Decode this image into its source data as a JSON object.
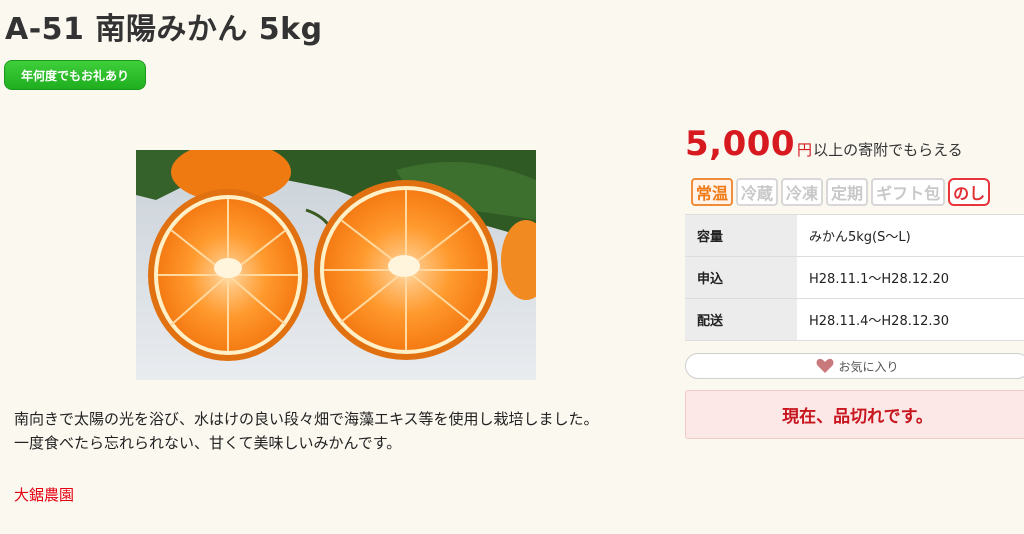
{
  "product": {
    "title": "A-51 南陽みかん 5kg",
    "badge": "年何度でもお礼あり",
    "description_lines": [
      "南向きで太陽の光を浴び、水はけの良い段々畑で海藻エキス等を使用し栽培しました。",
      "一度食べたら忘れられない、甘くて美味しいみかんです。"
    ],
    "farm": "大鋸農園"
  },
  "price": {
    "amount": "5,000",
    "unit": "円",
    "suffix": "以上の寄附でもらえる"
  },
  "tags": [
    {
      "label": "常温",
      "active": true
    },
    {
      "label": "冷蔵",
      "active": false
    },
    {
      "label": "冷凍",
      "active": false
    },
    {
      "label": "定期",
      "active": false
    },
    {
      "label": "ギフト包",
      "active": false
    },
    {
      "label": "のし",
      "active": true
    }
  ],
  "specs": [
    {
      "label": "容量",
      "value": "みかん5kg(S〜L)"
    },
    {
      "label": "申込",
      "value": "H28.11.1〜H28.12.20"
    },
    {
      "label": "配送",
      "value": "H28.11.4〜H28.12.30"
    }
  ],
  "favorite": {
    "label": "お気に入り",
    "icon": "heart-icon"
  },
  "status": {
    "label": "現在、品切れです。"
  },
  "colors": {
    "price": "#d71920",
    "badge": "#2ab82a",
    "farm": "#e60012",
    "soldout_bg": "#fde8e8"
  }
}
